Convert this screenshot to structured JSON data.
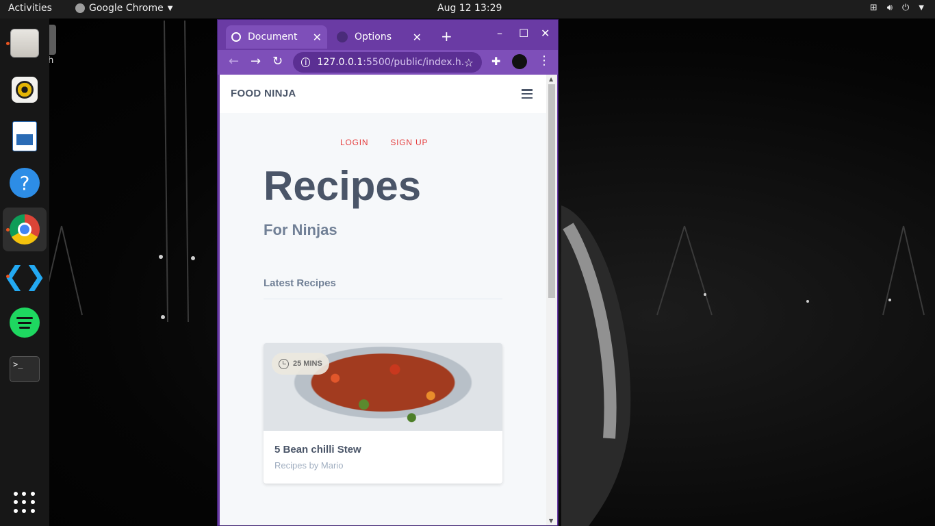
{
  "topbar": {
    "activities": "Activities",
    "app_name": "Google Chrome",
    "clock": "Aug 12  13:29"
  },
  "desktop": {
    "trash_label": "Trash"
  },
  "dock": {
    "items": [
      "files",
      "rhythmbox",
      "libreoffice-writer",
      "help",
      "google-chrome",
      "vscode",
      "spotify",
      "terminal"
    ],
    "terminal_glyph": ">_"
  },
  "browser": {
    "tabs": [
      {
        "label": "Document",
        "active": true
      },
      {
        "label": "Options",
        "active": false
      }
    ],
    "url_host": "127.0.0.1",
    "url_rest": ":5500/public/index.h...",
    "theme_color": "#6a3ba4"
  },
  "site": {
    "brand": "FOOD NINJA",
    "links": {
      "login": "LOGIN",
      "signup": "SIGN UP"
    },
    "hero_title": "Recipes",
    "hero_subtitle": "For Ninjas",
    "section_title": "Latest Recipes",
    "accent_color": "#e53e3e",
    "cards": [
      {
        "badge": "25 MINS",
        "title": "5 Bean chilli Stew",
        "meta": "Recipes by Mario"
      }
    ]
  }
}
